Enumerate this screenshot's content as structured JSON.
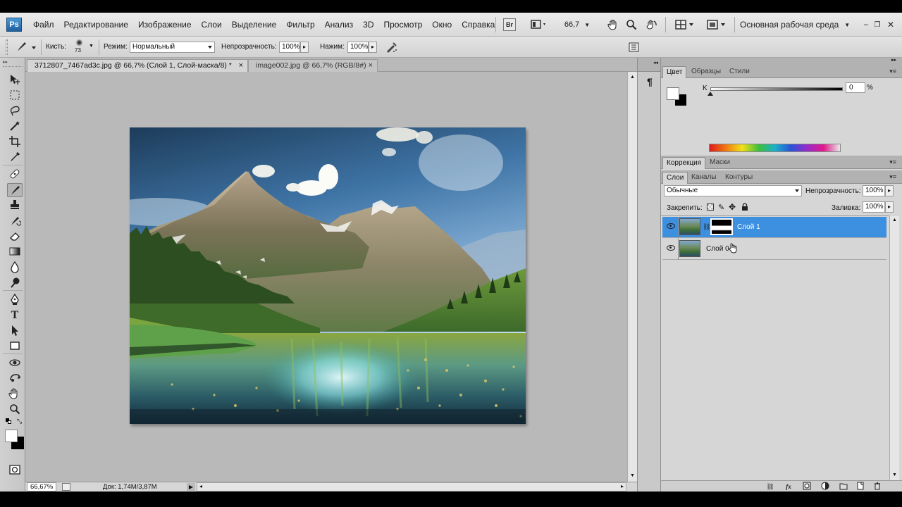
{
  "app": {
    "logo": "Ps"
  },
  "menu": {
    "items": [
      "Файл",
      "Редактирование",
      "Изображение",
      "Слои",
      "Выделение",
      "Фильтр",
      "Анализ",
      "3D",
      "Просмотр",
      "Окно",
      "Справка"
    ]
  },
  "menubar_right": {
    "bridge": "Br",
    "zoom": "66,7",
    "workspace": "Основная рабочая среда"
  },
  "options": {
    "brush_label": "Кисть:",
    "brush_size": "73",
    "mode_label": "Режим:",
    "mode_value": "Нормальный",
    "opacity_label": "Непрозрачность:",
    "opacity_value": "100%",
    "pressure_label": "Нажим:",
    "pressure_value": "100%"
  },
  "tabs": [
    {
      "label": "3712807_7467ad3c.jpg @ 66,7% (Слой 1, Слой-маска/8) *",
      "close": "×"
    },
    {
      "label": "image002.jpg @ 66,7% (RGB/8#)",
      "close": "×"
    }
  ],
  "status": {
    "zoom": "66,67%",
    "doc": "Док: 1,74M/3,87M"
  },
  "color_panel": {
    "tabs": [
      "Цвет",
      "Образцы",
      "Стили"
    ],
    "channel_label": "K",
    "value": "0",
    "unit": "%"
  },
  "adjust_panel": {
    "tabs": [
      "Коррекция",
      "Маски"
    ]
  },
  "layers_panel": {
    "tabs": [
      "Слои",
      "Каналы",
      "Контуры"
    ],
    "blend_mode": "Обычные",
    "opacity_label": "Непрозрачность:",
    "opacity_value": "100%",
    "lock_label": "Закрепить:",
    "fill_label": "Заливка:",
    "fill_value": "100%",
    "layers": [
      {
        "name": "Слой 1",
        "selected": true
      },
      {
        "name": "Слой 0",
        "selected": false
      }
    ]
  },
  "icons": [
    "hand-icon",
    "zoom-icon",
    "rotate-icon",
    "brush-icon",
    "paragraph-icon",
    "eye-icon",
    "link-icon",
    "fx-icon",
    "mask-icon",
    "adjustment-icon",
    "folder-icon",
    "new-layer-icon",
    "trash-icon"
  ],
  "colors": {
    "selected_layer": "#3d8fe0",
    "accent_tab": "#d6d6d6"
  }
}
